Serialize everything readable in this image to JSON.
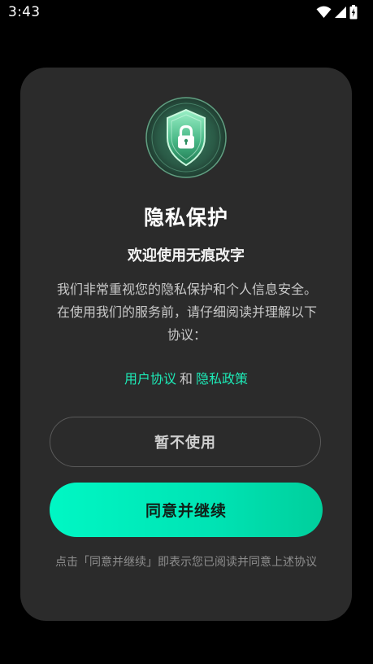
{
  "status_bar": {
    "time": "3:43",
    "icons": [
      "wifi-icon",
      "cellular-signal-icon",
      "battery-charging-icon"
    ]
  },
  "dialog": {
    "icon": "shield-lock-icon",
    "title": "隐私保护",
    "subtitle": "欢迎使用无痕改字",
    "description": "我们非常重视您的隐私保护和个人信息安全。在使用我们的服务前，请仔细阅读并理解以下协议：",
    "user_agreement_link": "用户协议",
    "conjunction": "和",
    "privacy_policy_link": "隐私政策",
    "decline_button": "暂不使用",
    "agree_button": "同意并继续",
    "footnote": "点击「同意并继续」即表示您已阅读并同意上述协议"
  },
  "colors": {
    "background": "#000000",
    "card": "#2b2b2b",
    "accent": "#1de9b6",
    "agree_gradient_start": "#00f7c4",
    "agree_gradient_end": "#00cf9c"
  }
}
